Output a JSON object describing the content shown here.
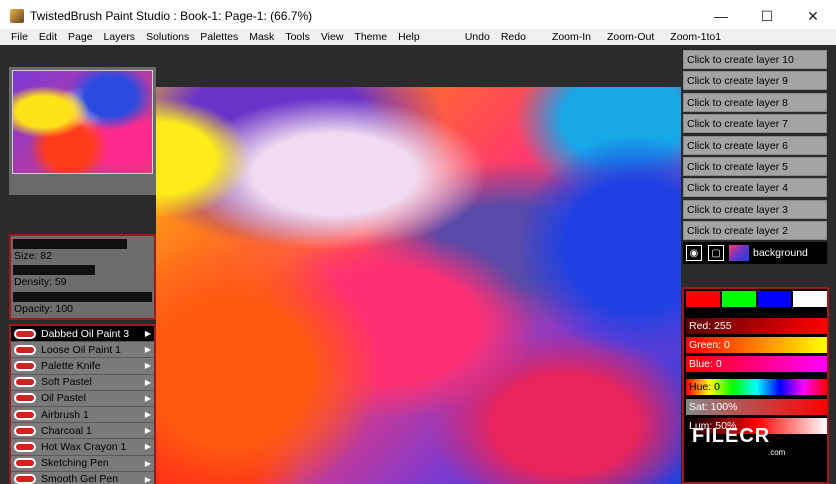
{
  "window": {
    "title": "TwistedBrush Paint Studio : Book-1: Page-1:  (66.7%)",
    "minimize": "—",
    "maximize": "☐",
    "close": "✕"
  },
  "menu": {
    "items": [
      "File",
      "Edit",
      "Page",
      "Layers",
      "Solutions",
      "Palettes",
      "Mask",
      "Tools",
      "View",
      "Theme",
      "Help"
    ],
    "actions": [
      "Undo",
      "Redo",
      "Zoom-In",
      "Zoom-Out",
      "Zoom-1to1"
    ]
  },
  "brush_props": {
    "size_label": "Size: 82",
    "density_label": "Density: 59",
    "opacity_label": "Opacity: 100",
    "size_value": 82,
    "density_value": 59,
    "opacity_value": 100
  },
  "brushes": [
    {
      "label": "Dabbed Oil Paint 3",
      "selected": true
    },
    {
      "label": "Loose Oil Paint 1",
      "selected": false
    },
    {
      "label": "Palette Knife",
      "selected": false
    },
    {
      "label": "Soft Pastel",
      "selected": false
    },
    {
      "label": "Oil Pastel",
      "selected": false
    },
    {
      "label": "Airbrush 1",
      "selected": false
    },
    {
      "label": "Charcoal 1",
      "selected": false
    },
    {
      "label": "Hot Wax Crayon 1",
      "selected": false
    },
    {
      "label": "Sketching Pen",
      "selected": false
    },
    {
      "label": "Smooth Gel Pen",
      "selected": false
    }
  ],
  "layers": {
    "create_buttons": [
      "Click to create layer 10",
      "Click to create layer 9",
      "Click to create layer 8",
      "Click to create layer 7",
      "Click to create layer 6",
      "Click to create layer 5",
      "Click to create layer 4",
      "Click to create layer 3",
      "Click to create layer 2"
    ],
    "background_label": "background"
  },
  "colors": {
    "swatches": [
      "#ff0000",
      "#00ff00",
      "#0000ff",
      "#ffffff"
    ],
    "red_label": "Red: 255",
    "green_label": "Green: 0",
    "blue_label": "Blue: 0",
    "hue_label": "Hue: 0",
    "sat_label": "Sat: 100%",
    "lum_label": "Lum: 50%"
  },
  "watermark": {
    "text": "FILECR",
    "sub": ".com"
  }
}
